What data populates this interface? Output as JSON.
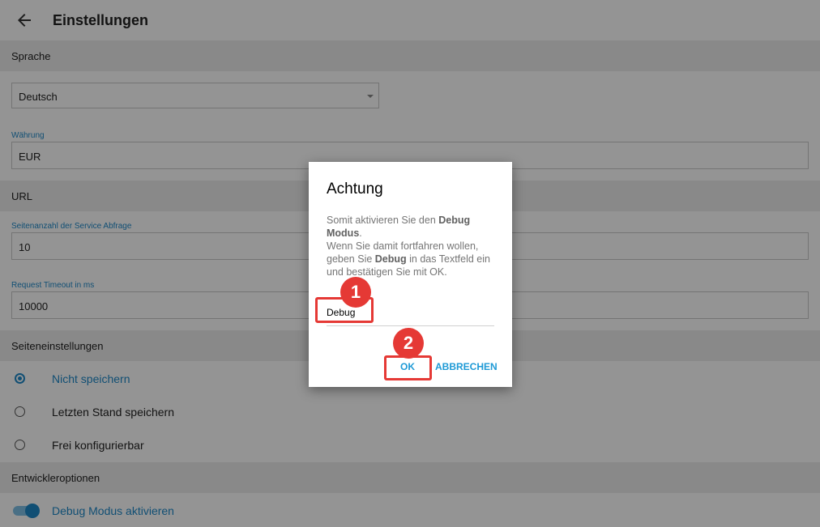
{
  "appbar": {
    "title": "Einstellungen"
  },
  "language": {
    "section": "Sprache",
    "value": "Deutsch"
  },
  "currency": {
    "label": "Währung",
    "value": "EUR"
  },
  "url": {
    "section": "URL"
  },
  "page_count": {
    "label": "Seitenanzahl der Service Abfrage",
    "value": "10"
  },
  "timeout": {
    "label": "Request Timeout in ms",
    "value": "10000"
  },
  "page_settings": {
    "section": "Seiteneinstellungen",
    "options": [
      "Nicht speichern",
      "Letzten Stand speichern",
      "Frei konfigurierbar"
    ],
    "selected": "Nicht speichern"
  },
  "dev": {
    "section": "Entwickleroptionen",
    "debug_label": "Debug Modus aktivieren",
    "debug_on": true
  },
  "dialog": {
    "title": "Achtung",
    "msg1": "Somit aktivieren Sie den ",
    "msg_bold1": "Debug Modus",
    "msg2": ".",
    "msg3": "Wenn Sie damit fortfahren wollen, geben Sie ",
    "msg_bold2": "Debug",
    "msg4": " in das Textfeld ein und bestätigen Sie mit OK.",
    "input_value": "Debug",
    "ok_label": "OK",
    "cancel_label": "ABBRECHEN"
  },
  "annotations": {
    "step1": "1",
    "step2": "2"
  },
  "colors": {
    "accent": "#1e88c8",
    "highlight": "#e53935"
  }
}
